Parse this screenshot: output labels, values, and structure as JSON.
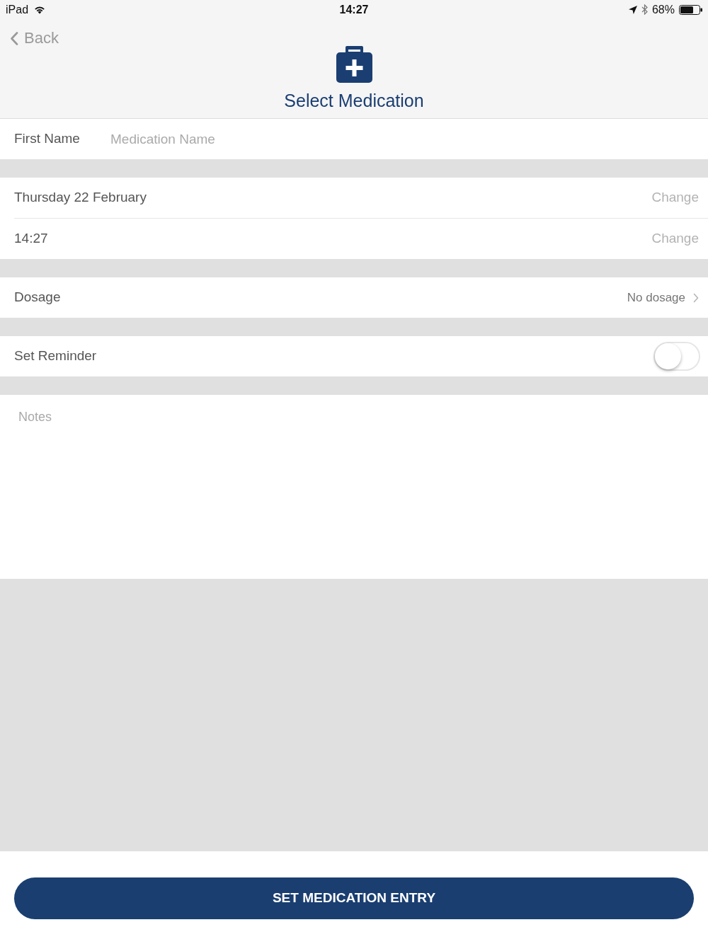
{
  "status_bar": {
    "device": "iPad",
    "time": "14:27",
    "battery": "68%"
  },
  "nav": {
    "back": "Back",
    "title": "Select Medication"
  },
  "name_row": {
    "label": "First Name",
    "placeholder": "Medication Name"
  },
  "datetime_rows": [
    {
      "value": "Thursday 22 February",
      "action": "Change"
    },
    {
      "value": "14:27",
      "action": "Change"
    }
  ],
  "dosage": {
    "label": "Dosage",
    "value": "No dosage"
  },
  "reminder": {
    "label": "Set Reminder",
    "on": false
  },
  "notes": {
    "placeholder": "Notes"
  },
  "submit": {
    "label": "SET MEDICATION ENTRY"
  }
}
